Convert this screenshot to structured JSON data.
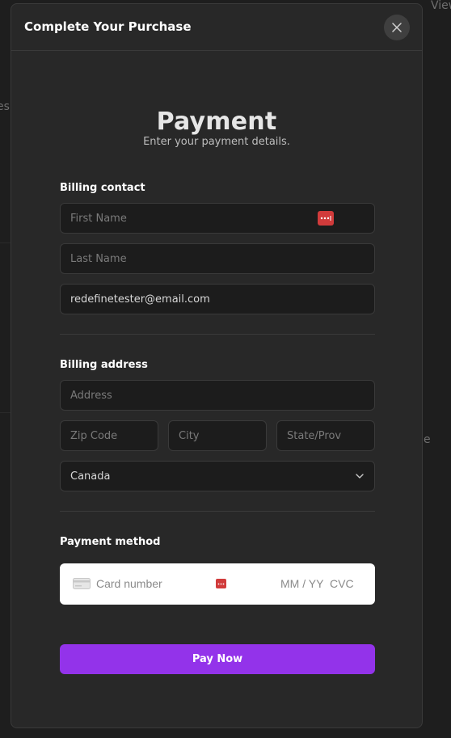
{
  "background": {
    "left_fragment": "es",
    "right_fragment": "View",
    "right_mid_fragment": "e"
  },
  "modal": {
    "title": "Complete Your Purchase"
  },
  "payment": {
    "heading": "Payment",
    "subheading": "Enter your payment details."
  },
  "billing_contact": {
    "label": "Billing contact",
    "first_name_placeholder": "First Name",
    "last_name_placeholder": "Last Name",
    "email_value": "redefinetester@email.com"
  },
  "billing_address": {
    "label": "Billing address",
    "address_placeholder": "Address",
    "zip_placeholder": "Zip Code",
    "city_placeholder": "City",
    "state_placeholder": "State/Prov",
    "country_value": "Canada"
  },
  "payment_method": {
    "label": "Payment method",
    "card_number_placeholder": "Card number",
    "expiry_placeholder": "MM / YY",
    "cvc_placeholder": "CVC"
  },
  "actions": {
    "pay_label": "Pay Now"
  },
  "colors": {
    "accent": "#9333ea",
    "password_manager": "#d13b3b"
  }
}
